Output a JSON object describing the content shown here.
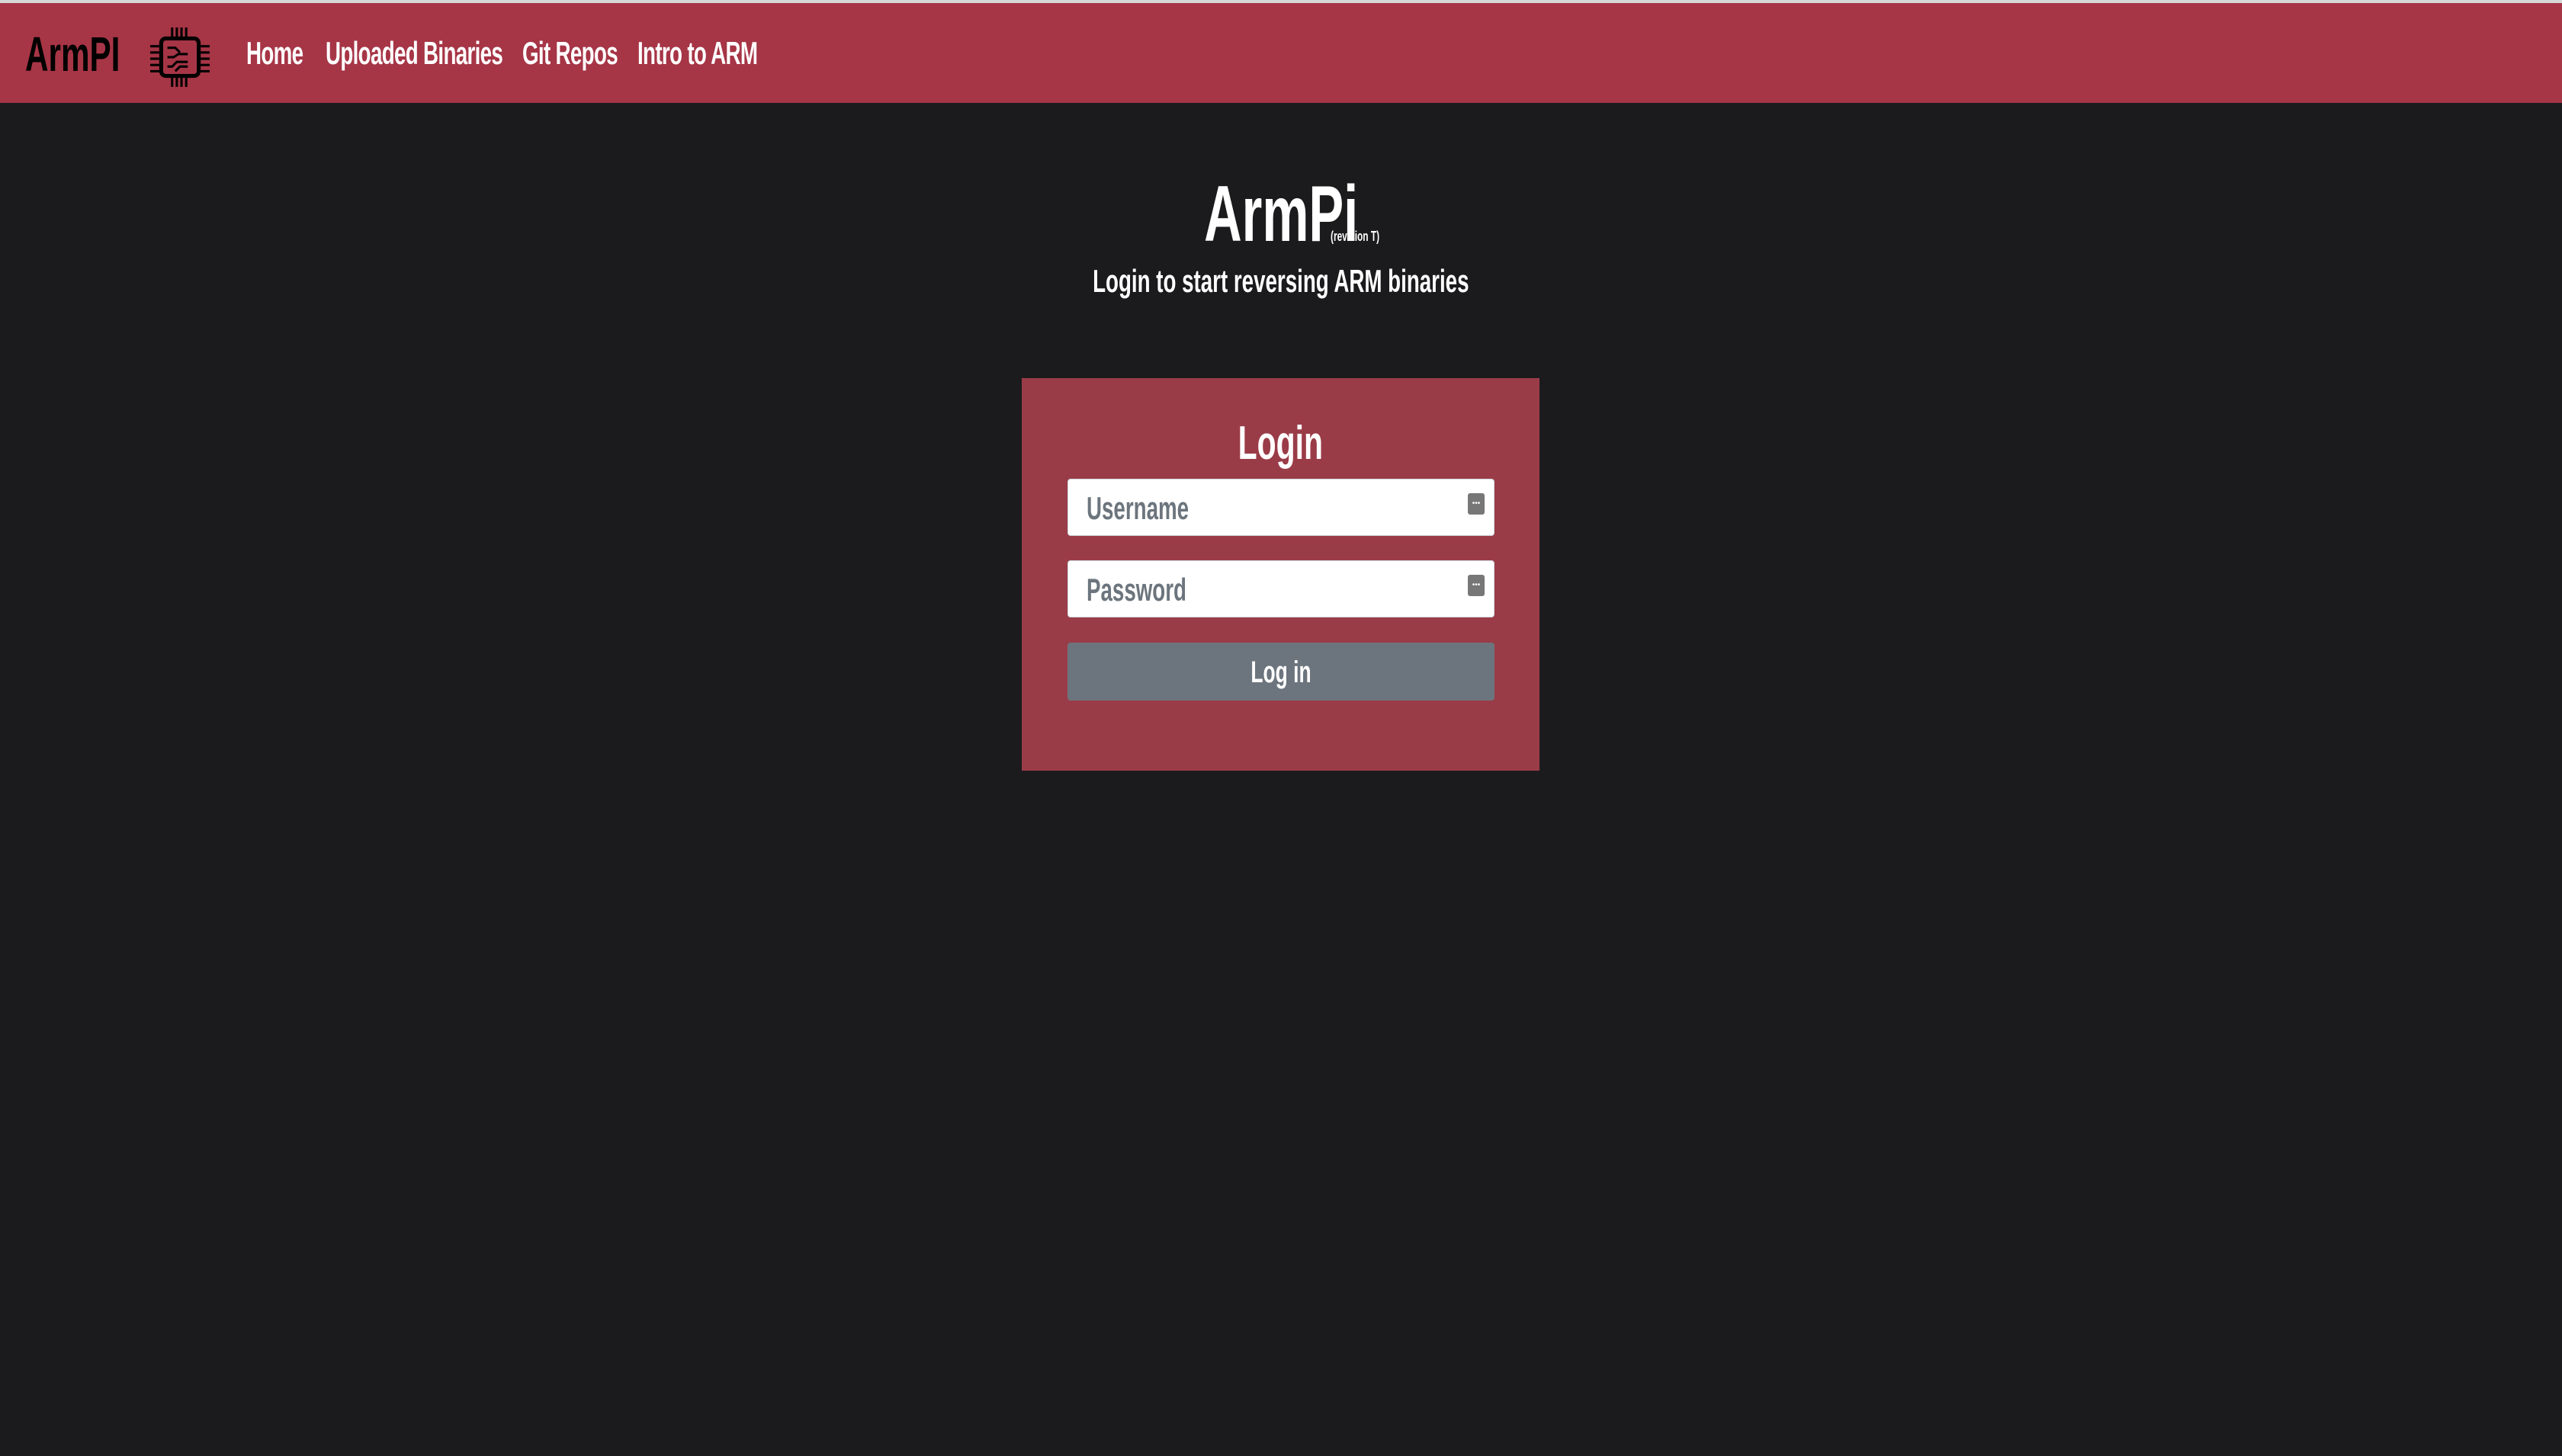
{
  "navbar": {
    "brand": "ArmPI",
    "logo_icon": "cpu-chip-icon",
    "links": [
      "Home",
      "Uploaded Binaries",
      "Git Repos",
      "Intro to ARM"
    ]
  },
  "header": {
    "title": "ArmPi",
    "revision": "(revision T)",
    "subtitle": "Login to start reversing ARM binaries"
  },
  "login": {
    "heading": "Login",
    "username_placeholder": "Username",
    "password_placeholder": "Password",
    "submit_label": "Log in",
    "field_icon": "password-manager-icon"
  },
  "colors": {
    "navbar": "#a63546",
    "background": "#1b1b1d",
    "card": "#9a3c48",
    "button": "#6c757d"
  }
}
